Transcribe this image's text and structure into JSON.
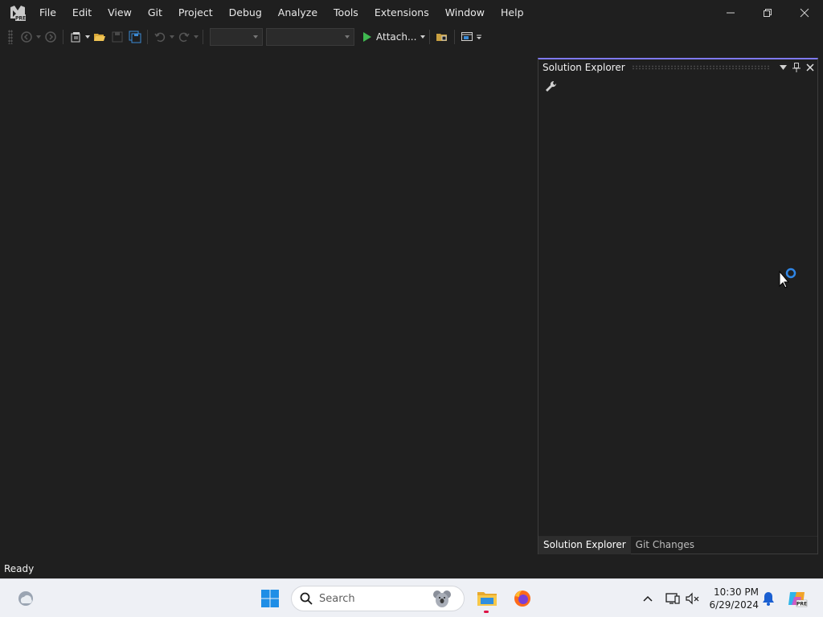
{
  "app": {
    "logo_badge": "PRE"
  },
  "menu": [
    "File",
    "Edit",
    "View",
    "Git",
    "Project",
    "Debug",
    "Analyze",
    "Tools",
    "Extensions",
    "Window",
    "Help"
  ],
  "toolbar": {
    "attach_label": "Attach..."
  },
  "solution_explorer": {
    "title": "Solution Explorer",
    "tabs": [
      {
        "label": "Solution Explorer",
        "active": true
      },
      {
        "label": "Git Changes",
        "active": false
      }
    ]
  },
  "status": {
    "text": "Ready"
  },
  "taskbar": {
    "search_label": "Search",
    "time": "10:30 PM",
    "date": "6/29/2024"
  },
  "colors": {
    "accent": "#7f79f2",
    "background": "#1f1f1f",
    "play_green": "#3fb950",
    "notification_blue": "#1a5fd1"
  }
}
